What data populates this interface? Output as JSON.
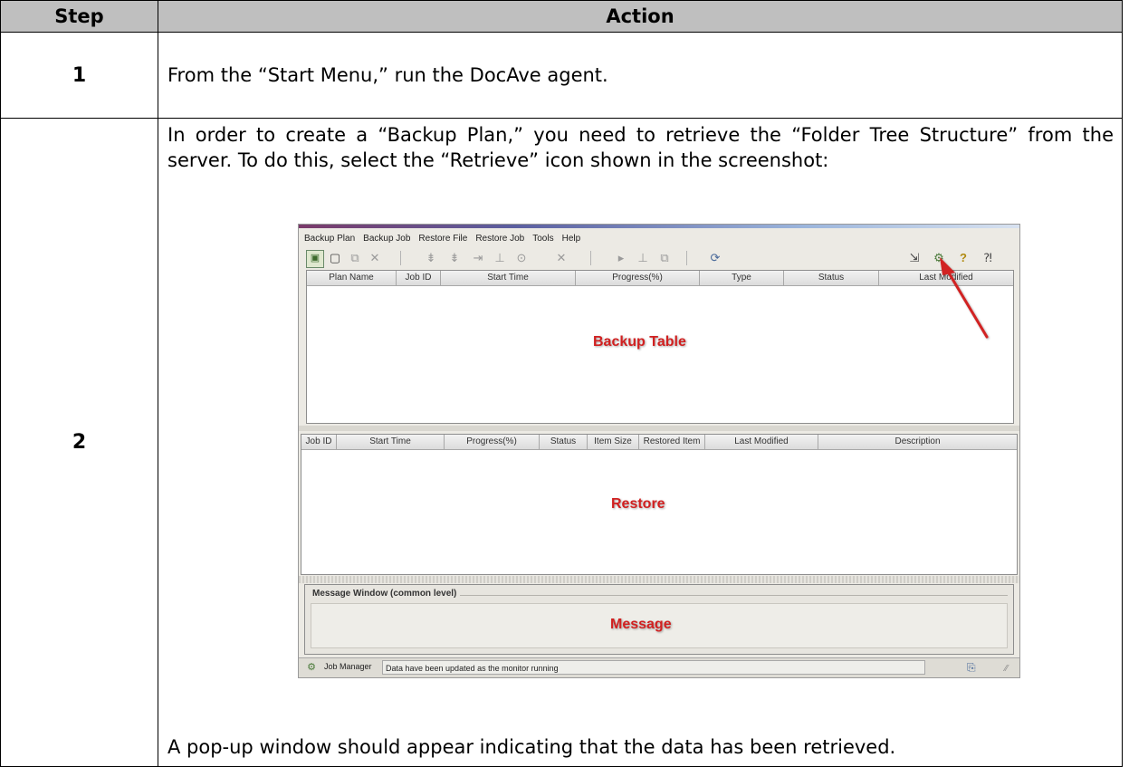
{
  "table": {
    "headers": {
      "step": "Step",
      "action": "Action"
    },
    "rows": [
      {
        "step": "1",
        "action": "From the “Start Menu,” run the DocAve agent."
      },
      {
        "step": "2",
        "intro": "In order to create a “Backup Plan,” you need to retrieve the “Folder Tree Structure” from the server. To do this, select the “Retrieve” icon shown in the screenshot:",
        "outro": "A pop-up window should appear indicating that the data has been retrieved."
      }
    ]
  },
  "screenshot": {
    "menu": [
      "Backup Plan",
      "Backup Job",
      "Restore File",
      "Restore Job",
      "Tools",
      "Help"
    ],
    "toolbar_icons": {
      "open_plan": "▣",
      "new": "▢",
      "copy": "⧉",
      "delete": "✕",
      "t1": "⇟",
      "t2": "⇟",
      "t3": "⇥",
      "t4": "⊥",
      "t5": "⊙",
      "t6": "✕",
      "t7": "▸",
      "t8": "⊥",
      "t9": "⧉",
      "t10": "⟳",
      "export": "⇲",
      "retrieve": "⚙",
      "help": "?",
      "whats_this": "⁈"
    },
    "backup_table": {
      "columns": [
        "Plan Name",
        "Job ID",
        "Start Time",
        "Progress(%)",
        "Type",
        "Status",
        "Last Modified"
      ],
      "label": "Backup Table"
    },
    "restore_table": {
      "columns": [
        "Job ID",
        "Start Time",
        "Progress(%)",
        "Status",
        "Item Size",
        "Restored Item",
        "Last Modified",
        "Description"
      ],
      "label": "Restore"
    },
    "message_window": {
      "title": "Message Window  (common level)",
      "label": "Message"
    },
    "status_bar": {
      "icon": "⚙",
      "job_manager": "Job Manager",
      "message": "Data have been updated as the monitor running",
      "right_icon": "⎘",
      "grip": "⁄⁄"
    },
    "colors": {
      "header_gray": "#bfbfbf",
      "annotation_red": "#d12020"
    }
  }
}
